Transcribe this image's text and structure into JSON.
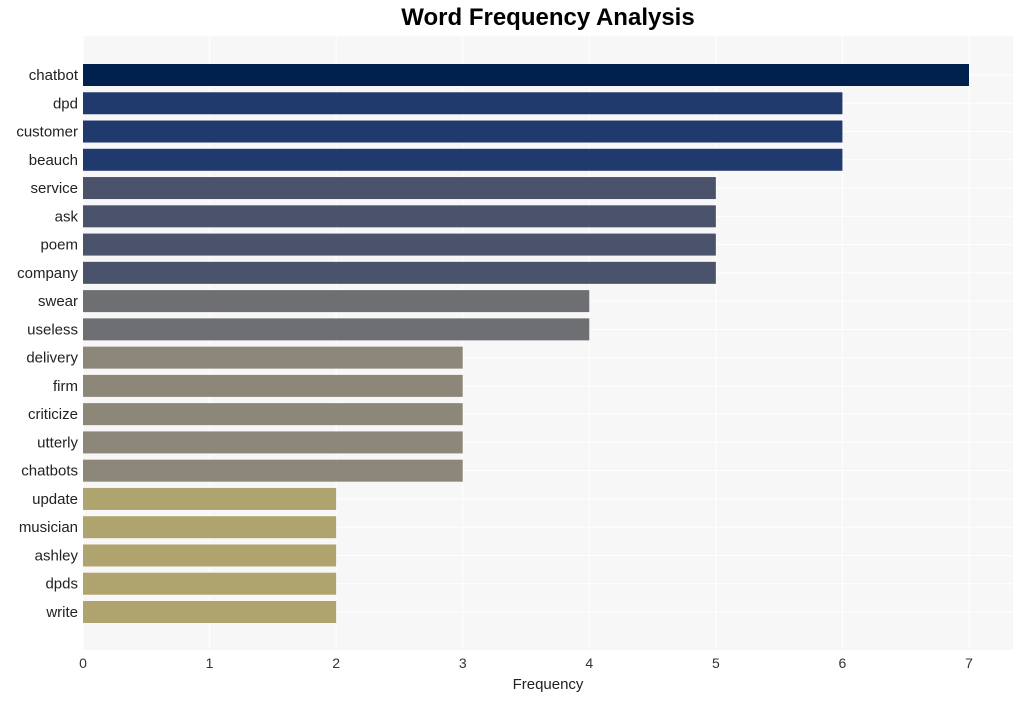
{
  "chart_data": {
    "type": "bar",
    "orientation": "horizontal",
    "title": "Word Frequency Analysis",
    "xlabel": "Frequency",
    "ylabel": "",
    "xlim": [
      0,
      7.35
    ],
    "xticks": [
      0,
      1,
      2,
      3,
      4,
      5,
      6,
      7
    ],
    "grid": true,
    "legend": "none",
    "categories": [
      "chatbot",
      "dpd",
      "customer",
      "beauch",
      "service",
      "ask",
      "poem",
      "company",
      "swear",
      "useless",
      "delivery",
      "firm",
      "criticize",
      "utterly",
      "chatbots",
      "update",
      "musician",
      "ashley",
      "dpds",
      "write"
    ],
    "values": [
      7,
      6,
      6,
      6,
      5,
      5,
      5,
      5,
      4,
      4,
      3,
      3,
      3,
      3,
      3,
      2,
      2,
      2,
      2,
      2
    ],
    "colors_by_value": {
      "7": "#00204e",
      "6": "#213a6e",
      "5": "#4b536c",
      "4": "#6e6f72",
      "3": "#8c8778",
      "2": "#b0a46e"
    },
    "plot_background": "#f7f7f7",
    "grid_color": "#ffffff"
  }
}
